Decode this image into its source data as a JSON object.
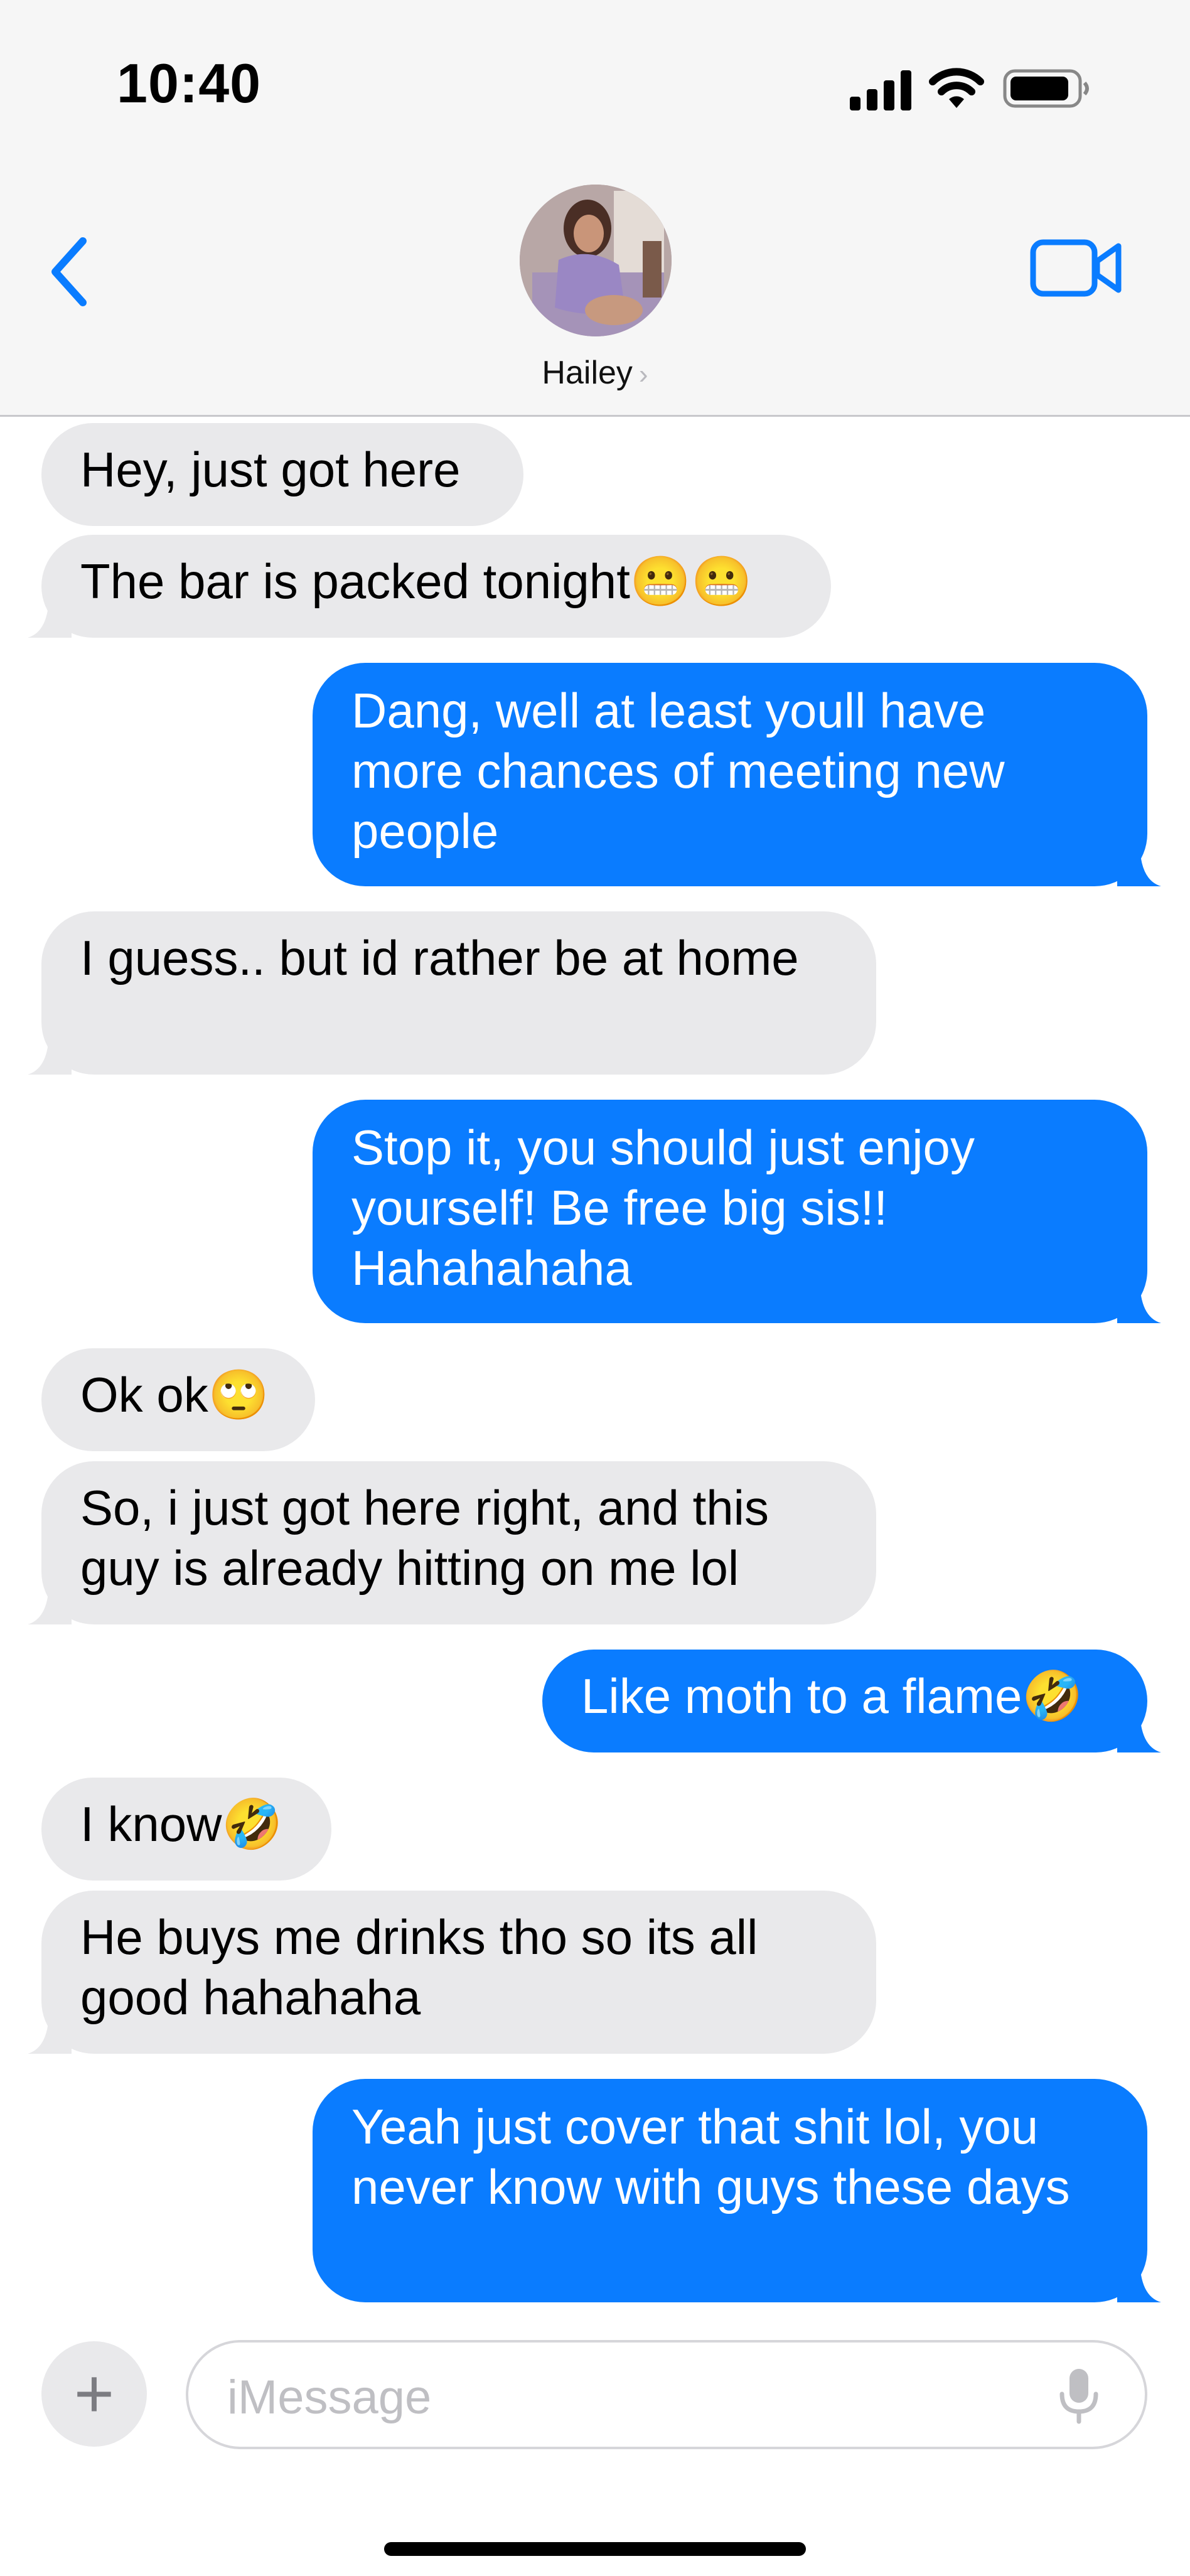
{
  "status_bar": {
    "time": "10:40",
    "icons": [
      "cellular-signal-icon",
      "wifi-icon",
      "battery-icon"
    ]
  },
  "header": {
    "contact_name": "Hailey",
    "chevron": "›",
    "icons": [
      "back-chevron-icon",
      "facetime-video-icon"
    ]
  },
  "colors": {
    "incoming_bubble": "#e9e9eb",
    "outgoing_bubble": "#0a7cff",
    "accent": "#0a7cff"
  },
  "messages": [
    {
      "direction": "in",
      "text": "Hey, just got here"
    },
    {
      "direction": "in",
      "text": "The bar is packed tonight😬😬"
    },
    {
      "direction": "out",
      "text": "Dang, well at least youll have more chances of meeting new people"
    },
    {
      "direction": "in",
      "text": "I guess.. but id rather be at home"
    },
    {
      "direction": "out",
      "text": "Stop it, you should just enjoy yourself! Be free big sis!! Hahahahaha"
    },
    {
      "direction": "in",
      "text": "Ok ok🙄"
    },
    {
      "direction": "in",
      "text": "So, i just got here right, and this guy is already hitting on me lol"
    },
    {
      "direction": "out",
      "text": "Like moth to a flame🤣"
    },
    {
      "direction": "in",
      "text": "I know🤣"
    },
    {
      "direction": "in",
      "text": "He buys me drinks tho so its all good hahahaha"
    },
    {
      "direction": "out",
      "text": "Yeah just cover that shit lol, you never know with guys these days"
    }
  ],
  "compose": {
    "plus_label": "+",
    "placeholder": "iMessage"
  }
}
